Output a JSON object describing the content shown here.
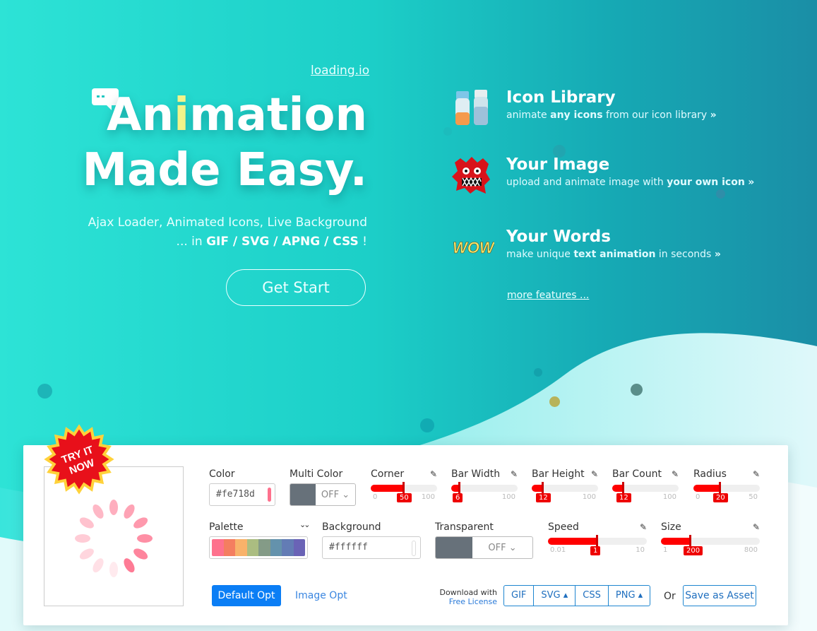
{
  "hero": {
    "brand_link": "loading.io",
    "headline_part1": "An",
    "headline_i": "i",
    "headline_part2": "mation",
    "headline_line2": "Made Easy.",
    "sub_line1": "Ajax Loader, Animated Icons, Live Background",
    "sub_line2_prefix": "... in ",
    "sub_line2_formats": "GIF / SVG / APNG / CSS",
    "sub_line2_suffix": " !",
    "cta_label": "Get Start"
  },
  "features": [
    {
      "title": "Icon Library",
      "desc_a": "animate ",
      "desc_b": "any icons",
      "desc_c": " from our icon library",
      "icon": "bottles-icon"
    },
    {
      "title": "Your Image",
      "desc_a": "upload and animate image with ",
      "desc_b": "your own icon",
      "desc_c": "",
      "icon": "monster-icon"
    },
    {
      "title": "Your Words",
      "desc_a": "make unique ",
      "desc_b": "text animation",
      "desc_c": " in seconds",
      "icon": "wow-text-icon"
    }
  ],
  "feature_arrow": "»",
  "wow_text": "WOW",
  "more_features": "more features ...",
  "badge": {
    "line1": "TRY IT",
    "line2": "NOW"
  },
  "controls": {
    "color": {
      "label": "Color",
      "value": "#fe718d",
      "swatch": "#fe718d"
    },
    "multi_color": {
      "label": "Multi Color",
      "state": "OFF"
    },
    "palette": {
      "label": "Palette",
      "colors": [
        "#fe718d",
        "#f47e60",
        "#f8b26a",
        "#abbd81",
        "#849b87",
        "#6492ac",
        "#637cb5",
        "#6a63b6"
      ]
    },
    "background": {
      "label": "Background",
      "value": "#ffffff"
    },
    "transparent": {
      "label": "Transparent",
      "state": "OFF"
    },
    "sliders": [
      {
        "label": "Corner",
        "min": "0",
        "max": "100",
        "value": "50",
        "fraction": 0.5
      },
      {
        "label": "Bar Width",
        "min": "",
        "max": "100",
        "value": "6",
        "fraction": 0.13
      },
      {
        "label": "Bar Height",
        "min": "",
        "max": "100",
        "value": "12",
        "fraction": 0.17
      },
      {
        "label": "Bar Count",
        "min": "",
        "max": "100",
        "value": "12",
        "fraction": 0.17
      },
      {
        "label": "Radius",
        "min": "0",
        "max": "50",
        "value": "20",
        "fraction": 0.4
      },
      {
        "label": "Speed",
        "min": "0.01",
        "max": "10",
        "value": "1",
        "fraction": 0.5
      },
      {
        "label": "Size",
        "min": "1",
        "max": "800",
        "value": "200",
        "fraction": 0.3
      }
    ],
    "toggle_caret": "⌄",
    "edit_icon": "✎",
    "expand_icon": "⌄⌄"
  },
  "buttons": {
    "default_opt": "Default Opt",
    "image_opt": "Image Opt",
    "download_with": "Download with",
    "free_license": "Free License",
    "formats": [
      "GIF",
      "SVG ▴",
      "CSS",
      "PNG ▴"
    ],
    "or": "Or",
    "save_asset": "Save as Asset"
  },
  "colors": {
    "accent": "#0b7ef5",
    "slider": "#ff0000",
    "spinner": "#fe718d"
  }
}
